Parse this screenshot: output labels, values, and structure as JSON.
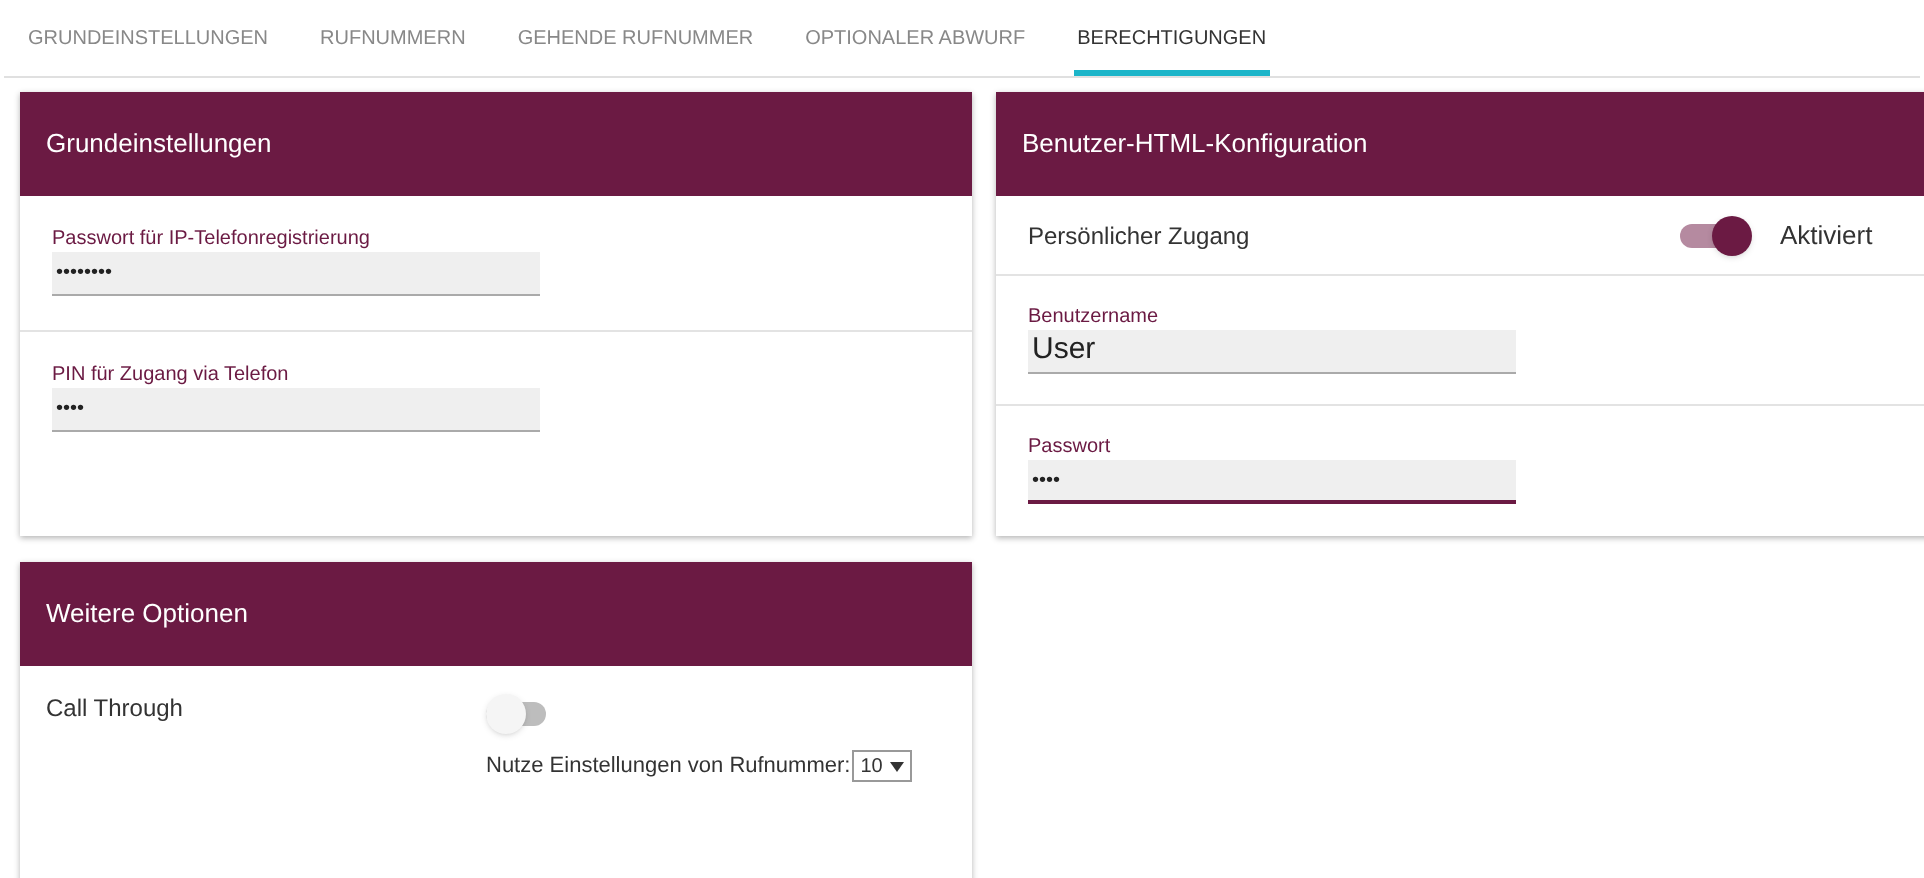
{
  "tabs": [
    {
      "label": "GRUNDEINSTELLUNGEN",
      "selected": false
    },
    {
      "label": "RUFNUMMERN",
      "selected": false
    },
    {
      "label": "GEHENDE RUFNUMMER",
      "selected": false
    },
    {
      "label": "OPTIONALER ABWURF",
      "selected": false
    },
    {
      "label": "BERECHTIGUNGEN",
      "selected": true
    }
  ],
  "basic_settings": {
    "title": "Grundeinstellungen",
    "fields": [
      {
        "label": "Passwort für IP-Telefonregistrierung",
        "value": "••••••••",
        "focused": false
      },
      {
        "label": "PIN für Zugang via Telefon",
        "value": "••••",
        "focused": false
      }
    ]
  },
  "html_config": {
    "title": "Benutzer-HTML-Konfiguration",
    "access": {
      "label": "Persönlicher Zugang",
      "on": true,
      "status": "Aktiviert"
    },
    "fields": [
      {
        "label": "Benutzername",
        "value": "User",
        "focused": false
      },
      {
        "label": "Passwort",
        "value": "••••",
        "focused": true
      }
    ]
  },
  "more_options": {
    "title": "Weitere Optionen",
    "call_through": {
      "label": "Call Through",
      "on": false
    },
    "number_setting": {
      "label": "Nutze Einstellungen von Rufnummer:",
      "value": "10"
    }
  }
}
